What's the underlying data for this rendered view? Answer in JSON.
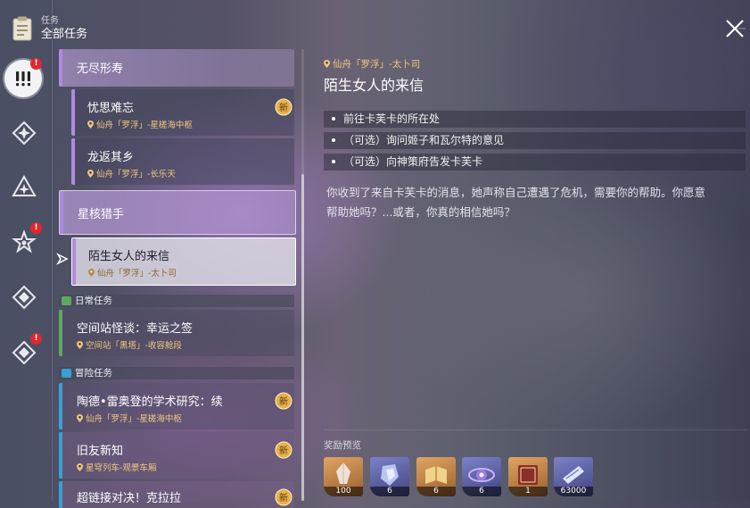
{
  "header": {
    "category_label": "任务",
    "title": "全部任务"
  },
  "rail": {
    "items": [
      {
        "icon": "exclamation-icon",
        "active": true,
        "badge": "!"
      },
      {
        "icon": "diamond-star-icon",
        "active": false,
        "badge": ""
      },
      {
        "icon": "triangle-star-icon",
        "active": false,
        "badge": ""
      },
      {
        "icon": "star-icon",
        "active": false,
        "badge": "!"
      },
      {
        "icon": "diamond-compass-icon",
        "active": false,
        "badge": ""
      },
      {
        "icon": "diamond-compass-icon",
        "active": false,
        "badge": "!"
      }
    ]
  },
  "quest_list": {
    "group_wuqin": {
      "title": "无尽形寿"
    },
    "q1": {
      "title": "忧思难忘",
      "location": "仙舟「罗浮」-星槎海中枢",
      "new_badge": "新"
    },
    "q2": {
      "title": "龙返其乡",
      "location": "仙舟「罗浮」-长乐天"
    },
    "group_xinghe": {
      "title": "星核猎手"
    },
    "q3": {
      "title": "陌生女人的来信",
      "location": "仙舟「罗浮」-太卜司"
    },
    "section_daily": {
      "label": "日常任务"
    },
    "q4": {
      "title": "空间站怪谈：幸运之签",
      "location": "空间站「黑塔」-收容舱段"
    },
    "section_adventure": {
      "label": "冒险任务"
    },
    "q5": {
      "title": "陶德•雷奥登的学术研究：续",
      "location": "仙舟「罗浮」-星槎海中枢",
      "new_badge": "新"
    },
    "q6": {
      "title": "旧友新知",
      "location": "星穹列车-观景车厢",
      "new_badge": "新"
    },
    "q7": {
      "title": "超链接对决！克拉拉",
      "new_badge": "新"
    }
  },
  "detail": {
    "location": "仙舟「罗浮」-太卜司",
    "title": "陌生女人的来信",
    "objectives": [
      "前往卡芙卡的所在处",
      "（可选）询问姬子和瓦尔特的意见",
      "（可选）向神策府告发卡芙卡"
    ],
    "description_line1": "你收到了来自卡芙卡的消息，她声称自己遭遇了危机，需要你的帮助。你愿意",
    "description_line2": "帮助她吗？...或者，你真的相信她吗？",
    "reward_label": "奖励预览",
    "rewards": [
      {
        "icon": "crystal-icon",
        "count": "100",
        "color": "#c9874a"
      },
      {
        "icon": "crystal-shard-icon",
        "count": "6",
        "color": "#6a6fb8"
      },
      {
        "icon": "book-icon",
        "count": "6",
        "color": "#c9874a"
      },
      {
        "icon": "orb-icon",
        "count": "6",
        "color": "#6a6fb8"
      },
      {
        "icon": "tome-icon",
        "count": "1",
        "color": "#c9874a"
      },
      {
        "icon": "credit-ticket-icon",
        "count": "63000",
        "color": "#6a6fb8"
      }
    ]
  },
  "colors": {
    "accent_gold": "#f0c77a",
    "purple_bar": "#b08ae0",
    "green_bar": "#5fa85f",
    "blue_bar": "#3b9fd4",
    "badge_red": "#e0262e"
  }
}
